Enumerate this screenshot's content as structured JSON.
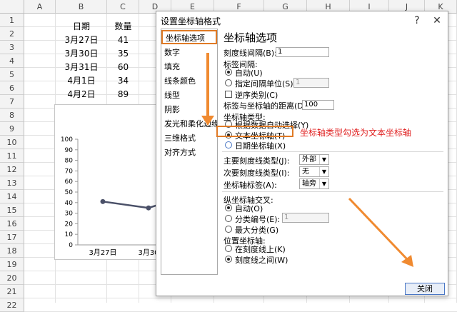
{
  "sheet": {
    "columns": [
      "A",
      "B",
      "C",
      "D",
      "E",
      "F",
      "G",
      "H",
      "I",
      "J",
      "K"
    ],
    "rows": [
      "1",
      "2",
      "3",
      "4",
      "5",
      "6",
      "7",
      "8",
      "9",
      "10",
      "11",
      "12",
      "13",
      "14",
      "15",
      "16",
      "17",
      "18",
      "19",
      "20",
      "21",
      "22"
    ],
    "table": {
      "headers": [
        "日期",
        "数量"
      ],
      "rows": [
        [
          "3月27日",
          "41"
        ],
        [
          "3月30日",
          "35"
        ],
        [
          "3月31日",
          "60"
        ],
        [
          "4月1日",
          "34"
        ],
        [
          "4月2日",
          "89"
        ]
      ]
    }
  },
  "chart_data": {
    "type": "line",
    "categories": [
      "3月27日",
      "3月30"
    ],
    "values": [
      41,
      35
    ],
    "ylim": [
      0,
      100
    ],
    "yticks": [
      "100",
      "90",
      "80",
      "70",
      "60",
      "50",
      "40",
      "30",
      "20",
      "10",
      "0"
    ],
    "line_color": "#4a5068"
  },
  "dialog": {
    "title": "设置坐标轴格式",
    "help_icon": "?",
    "close_icon": "✕",
    "nav": [
      "坐标轴选项",
      "数字",
      "填充",
      "线条颜色",
      "线型",
      "阴影",
      "发光和柔化边缘",
      "三维格式",
      "对齐方式"
    ],
    "nav_selected": 0,
    "section_title": "坐标轴选项",
    "tick_interval_label": "刻度线间隔(B):",
    "tick_interval_value": "1",
    "label_interval_label": "标签间隔:",
    "auto_label": "自动(U)",
    "specify_unit_label": "指定间隔单位(S):",
    "specify_unit_value": "1",
    "reverse_label": "逆序类别(C)",
    "label_distance_label": "标签与坐标轴的距离(D):",
    "label_distance_value": "100",
    "axis_type_label": "坐标轴类型:",
    "axis_type_auto": "根据数据自动选择(Y)",
    "axis_type_text": "文本坐标轴(T)",
    "axis_type_date": "日期坐标轴(X)",
    "major_tick_label": "主要刻度线类型(J):",
    "major_tick_value": "外部",
    "minor_tick_label": "次要刻度线类型(I):",
    "minor_tick_value": "无",
    "axis_label_label": "坐标轴标签(A):",
    "axis_label_value": "轴旁",
    "cross_label": "纵坐标轴交叉:",
    "cross_auto": "自动(O)",
    "cross_category": "分类编号(E):",
    "cross_category_value": "1",
    "cross_max": "最大分类(G)",
    "position_label": "位置坐标轴:",
    "position_on_tick": "在刻度线上(K)",
    "position_between": "刻度线之间(W)",
    "close_button": "关闭"
  },
  "annotation": {
    "text": "坐标轴类型勾选为文本坐标轴",
    "color": "#e02020",
    "arrow_color": "#f08a30",
    "highlight_color": "#e07a25"
  }
}
